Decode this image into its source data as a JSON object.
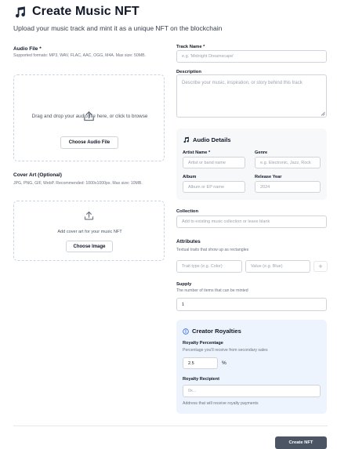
{
  "page": {
    "title": "Create Music NFT",
    "subtitle": "Upload your music track and mint it as a unique NFT on the blockchain"
  },
  "audio_file": {
    "label": "Audio File *",
    "hint": "Supported formats: MP3, WAV, FLAC, AAC, OGG, M4A. Max size: 50MB.",
    "drop_text": "Drag and drop your audio file here, or click to browse",
    "button": "Choose Audio File"
  },
  "cover_art": {
    "label": "Cover Art (Optional)",
    "hint": "JPG, PNG, GIF, WebP. Recommended: 1000x1000px. Max size: 10MB.",
    "drop_text": "Add cover art for your music NFT",
    "button": "Choose Image"
  },
  "track_name": {
    "label": "Track Name *",
    "placeholder": "e.g. 'Midnight Dreamscape'"
  },
  "description": {
    "label": "Description",
    "placeholder": "Describe your music, inspiration, or story behind this track"
  },
  "audio_details": {
    "title": "Audio Details",
    "artist": {
      "label": "Artist Name *",
      "placeholder": "Artist or band name"
    },
    "genre": {
      "label": "Genre",
      "placeholder": "e.g. Electronic, Jazz, Rock"
    },
    "album": {
      "label": "Album",
      "placeholder": "Album or EP name"
    },
    "year": {
      "label": "Release Year",
      "value": "2024"
    }
  },
  "collection": {
    "label": "Collection",
    "placeholder": "Add to existing music collection or leave blank"
  },
  "attributes": {
    "label": "Attributes",
    "hint": "Textual traits that show up as rectangles",
    "trait_placeholder": "Trait type (e.g. Color)",
    "value_placeholder": "Value (e.g. Blue)",
    "add_symbol": "+"
  },
  "supply": {
    "label": "Supply",
    "hint": "The number of items that can be minted",
    "value": "1"
  },
  "royalties": {
    "title": "Creator Royalties",
    "percentage_label": "Royalty Percentage",
    "percentage_hint": "Percentage you'll receive from secondary sales",
    "percentage_value": "2.5",
    "percent_sign": "%",
    "recipient_label": "Royalty Recipient",
    "recipient_placeholder": "0x...",
    "recipient_hint": "Address that will receive royalty payments"
  },
  "footer": {
    "submit": "Create NFT"
  },
  "colors": {
    "accent": "#2563eb",
    "primary_button": "#4b5563",
    "panel_blue": "#eef4fd",
    "panel_gray": "#f7f8fa"
  },
  "icons": {
    "logo": "music-note-icon",
    "upload": "upload-icon",
    "details": "music-note-icon",
    "info": "info-icon"
  }
}
